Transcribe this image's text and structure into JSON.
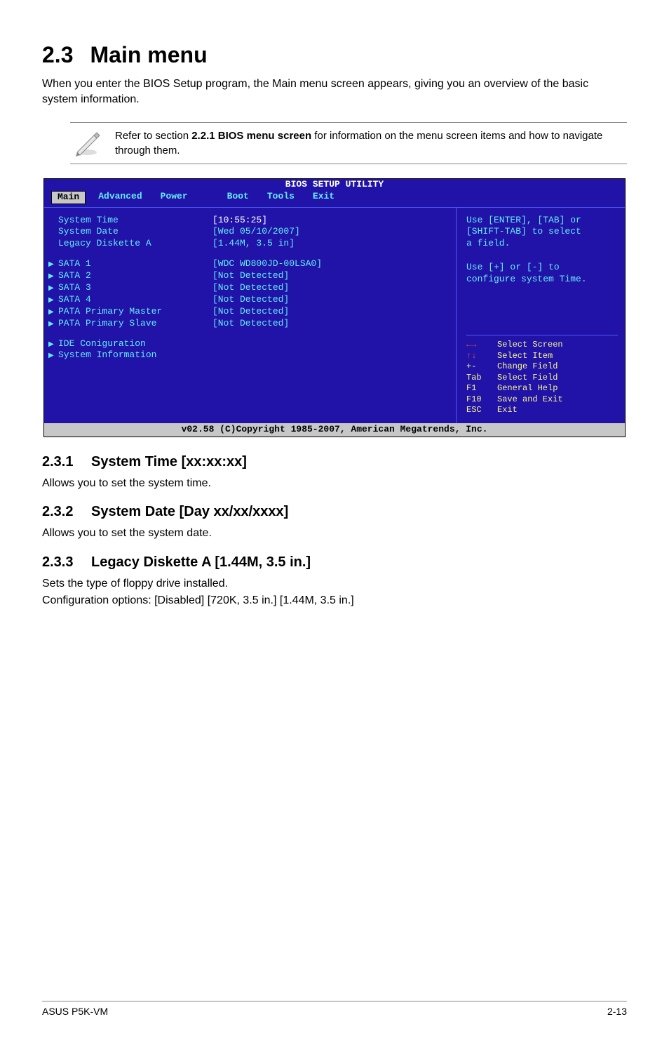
{
  "section": {
    "number": "2.3",
    "title": "Main menu"
  },
  "intro": "When you enter the BIOS Setup program, the Main menu screen appears, giving you an overview of the basic system information.",
  "note": {
    "text_pre": "Refer to section ",
    "bold": "2.2.1  BIOS menu screen",
    "text_post": " for information on the menu screen items and how to navigate through them."
  },
  "bios": {
    "header": "BIOS SETUP UTILITY",
    "menu": [
      "Main",
      "Advanced",
      "Power",
      "Boot",
      "Tools",
      "Exit"
    ],
    "active_menu": 0,
    "fields": [
      {
        "label": "System Time",
        "value": "[10:55:25]",
        "selected": true
      },
      {
        "label": "System Date",
        "value": "[Wed 05/10/2007]"
      },
      {
        "label": "Legacy Diskette A",
        "value": "[1.44M, 3.5 in]"
      }
    ],
    "drives": [
      {
        "arrow": true,
        "label": "SATA 1",
        "value": "[WDC WD800JD-00LSA0]"
      },
      {
        "arrow": true,
        "label": "SATA 2",
        "value": "[Not Detected]"
      },
      {
        "arrow": true,
        "label": "SATA 3",
        "value": "[Not Detected]"
      },
      {
        "arrow": true,
        "label": "SATA 4",
        "value": "[Not Detected]"
      },
      {
        "arrow": true,
        "label": "PATA Primary Master",
        "value": "[Not Detected]"
      },
      {
        "arrow": true,
        "label": "PATA Primary Slave",
        "value": "[Not Detected]"
      }
    ],
    "extras": [
      {
        "arrow": true,
        "label": "IDE Coniguration"
      },
      {
        "arrow": true,
        "label": "System Information"
      }
    ],
    "help_top": [
      "Use [ENTER], [TAB] or",
      "[SHIFT-TAB] to select",
      "a field.",
      "",
      "Use [+] or [-] to",
      "configure system Time."
    ],
    "help_keys": [
      {
        "k": "←→",
        "d": "Select Screen",
        "sym": true
      },
      {
        "k": "↑↓",
        "d": "Select Item",
        "sym": true
      },
      {
        "k": "+-",
        "d": "Change Field"
      },
      {
        "k": "Tab",
        "d": "Select Field"
      },
      {
        "k": "F1",
        "d": "General Help"
      },
      {
        "k": "F10",
        "d": "Save and Exit"
      },
      {
        "k": "ESC",
        "d": "Exit"
      }
    ],
    "footer": "v02.58 (C)Copyright 1985-2007, American Megatrends, Inc."
  },
  "subs": [
    {
      "num": "2.3.1",
      "title": "System Time [xx:xx:xx]",
      "body": "Allows you to set the system time."
    },
    {
      "num": "2.3.2",
      "title": "System Date [Day xx/xx/xxxx]",
      "body": "Allows you to set the system date."
    },
    {
      "num": "2.3.3",
      "title": "Legacy Diskette A [1.44M, 3.5 in.]",
      "body": "Sets the type of floppy drive installed.\nConfiguration options: [Disabled] [720K, 3.5 in.] [1.44M, 3.5 in.]"
    }
  ],
  "page_footer": {
    "left": "ASUS P5K-VM",
    "right": "2-13"
  }
}
